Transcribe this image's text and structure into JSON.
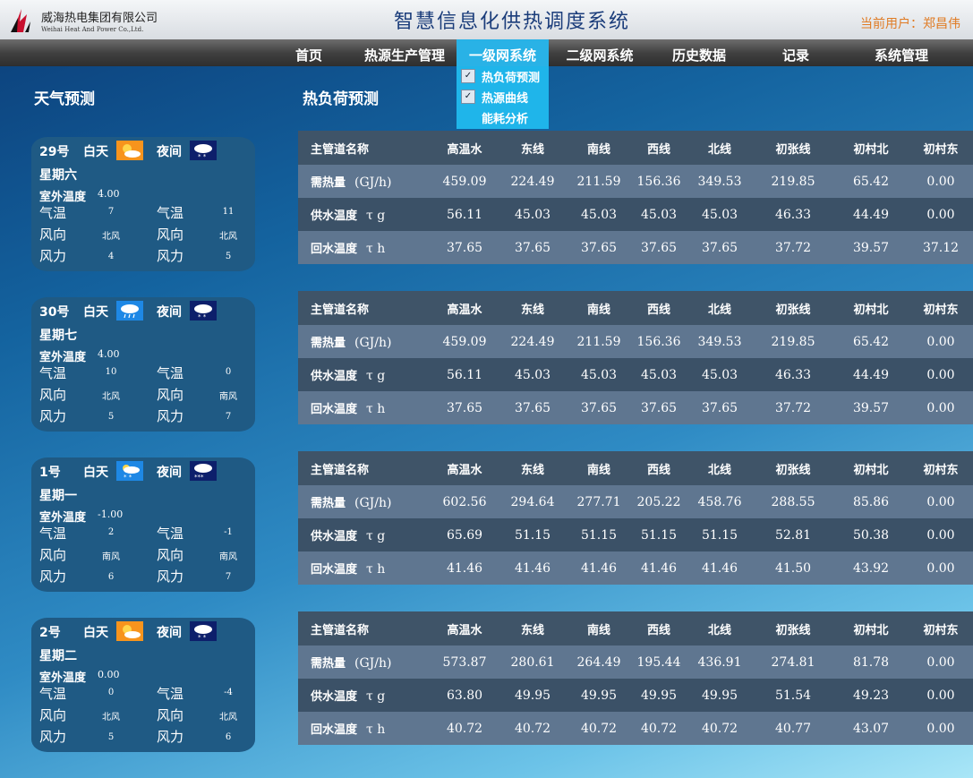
{
  "header": {
    "company_cn": "威海热电集团有限公司",
    "company_en": "Weihai Heat And Power Co.,Ltd.",
    "system_title": "智慧信息化供热调度系统",
    "user_label": "当前用户：",
    "user_name": "郑昌伟"
  },
  "nav": {
    "items": [
      "首页",
      "热源生产管理",
      "一级网系统",
      "二级网系统",
      "历史数据",
      "记录",
      "系统管理"
    ],
    "active": "一级网系统",
    "dropdown": [
      {
        "label": "热负荷预测",
        "checked": true
      },
      {
        "label": "热源曲线",
        "checked": true
      },
      {
        "label": "能耗分析",
        "checked": false
      }
    ]
  },
  "weather_title": "天气预测",
  "load_title": "热负荷预测",
  "weather": [
    {
      "date": "29号",
      "day_label": "白天",
      "night_label": "夜间",
      "day_icon": "sun-cloud-icon",
      "night_icon": "snow-cloud-icon",
      "weekday": "星期六",
      "outdoor_label": "室外温度",
      "outdoor": "4.00",
      "temp_label": "气温",
      "dir_label": "风向",
      "force_label": "风力",
      "day_temp": "7",
      "night_temp": "11",
      "day_dir": "北风",
      "night_dir": "北风",
      "day_force": "4",
      "night_force": "5"
    },
    {
      "date": "30号",
      "day_label": "白天",
      "night_label": "夜间",
      "day_icon": "rain-cloud-icon",
      "night_icon": "snow-cloud-icon",
      "weekday": "星期七",
      "outdoor_label": "室外温度",
      "outdoor": "4.00",
      "temp_label": "气温",
      "dir_label": "风向",
      "force_label": "风力",
      "day_temp": "10",
      "night_temp": "0",
      "day_dir": "北风",
      "night_dir": "南风",
      "day_force": "5",
      "night_force": "7"
    },
    {
      "date": "1号",
      "day_label": "白天",
      "night_label": "夜间",
      "day_icon": "sun-snow-icon",
      "night_icon": "heavy-snow-icon",
      "weekday": "星期一",
      "outdoor_label": "室外温度",
      "outdoor": "-1.00",
      "temp_label": "气温",
      "dir_label": "风向",
      "force_label": "风力",
      "day_temp": "2",
      "night_temp": "-1",
      "day_dir": "南风",
      "night_dir": "南风",
      "day_force": "6",
      "night_force": "7"
    },
    {
      "date": "2号",
      "day_label": "白天",
      "night_label": "夜间",
      "day_icon": "sun-cloud-icon",
      "night_icon": "snow-cloud-icon",
      "weekday": "星期二",
      "outdoor_label": "室外温度",
      "outdoor": "0.00",
      "temp_label": "气温",
      "dir_label": "风向",
      "force_label": "风力",
      "day_temp": "0",
      "night_temp": "-4",
      "day_dir": "北风",
      "night_dir": "北风",
      "day_force": "5",
      "night_force": "6"
    }
  ],
  "table_header": {
    "name_label": "主管道名称",
    "lines": [
      "高温水",
      "东线",
      "南线",
      "西线",
      "北线",
      "初张线",
      "初村北",
      "初村东"
    ],
    "row_labels": [
      "需热量",
      "供水温度",
      "回水温度"
    ],
    "row_units": [
      "(GJ/h)",
      "τ g",
      "τ h"
    ]
  },
  "tables": [
    {
      "rows": [
        [
          "459.09",
          "224.49",
          "211.59",
          "156.36",
          "349.53",
          "219.85",
          "65.42",
          "0.00"
        ],
        [
          "56.11",
          "45.03",
          "45.03",
          "45.03",
          "45.03",
          "46.33",
          "44.49",
          "0.00"
        ],
        [
          "37.65",
          "37.65",
          "37.65",
          "37.65",
          "37.65",
          "37.72",
          "39.57",
          "37.12"
        ]
      ]
    },
    {
      "rows": [
        [
          "459.09",
          "224.49",
          "211.59",
          "156.36",
          "349.53",
          "219.85",
          "65.42",
          "0.00"
        ],
        [
          "56.11",
          "45.03",
          "45.03",
          "45.03",
          "45.03",
          "46.33",
          "44.49",
          "0.00"
        ],
        [
          "37.65",
          "37.65",
          "37.65",
          "37.65",
          "37.65",
          "37.72",
          "39.57",
          "0.00"
        ]
      ]
    },
    {
      "rows": [
        [
          "602.56",
          "294.64",
          "277.71",
          "205.22",
          "458.76",
          "288.55",
          "85.86",
          "0.00"
        ],
        [
          "65.69",
          "51.15",
          "51.15",
          "51.15",
          "51.15",
          "52.81",
          "50.38",
          "0.00"
        ],
        [
          "41.46",
          "41.46",
          "41.46",
          "41.46",
          "41.46",
          "41.50",
          "43.92",
          "0.00"
        ]
      ]
    },
    {
      "rows": [
        [
          "573.87",
          "280.61",
          "264.49",
          "195.44",
          "436.91",
          "274.81",
          "81.78",
          "0.00"
        ],
        [
          "63.80",
          "49.95",
          "49.95",
          "49.95",
          "49.95",
          "51.54",
          "49.23",
          "0.00"
        ],
        [
          "40.72",
          "40.72",
          "40.72",
          "40.72",
          "40.72",
          "40.77",
          "43.07",
          "0.00"
        ]
      ]
    }
  ],
  "colors": {
    "accent": "#29b2e6",
    "user_text": "#e07b24",
    "title_text": "#1a3c7a"
  }
}
